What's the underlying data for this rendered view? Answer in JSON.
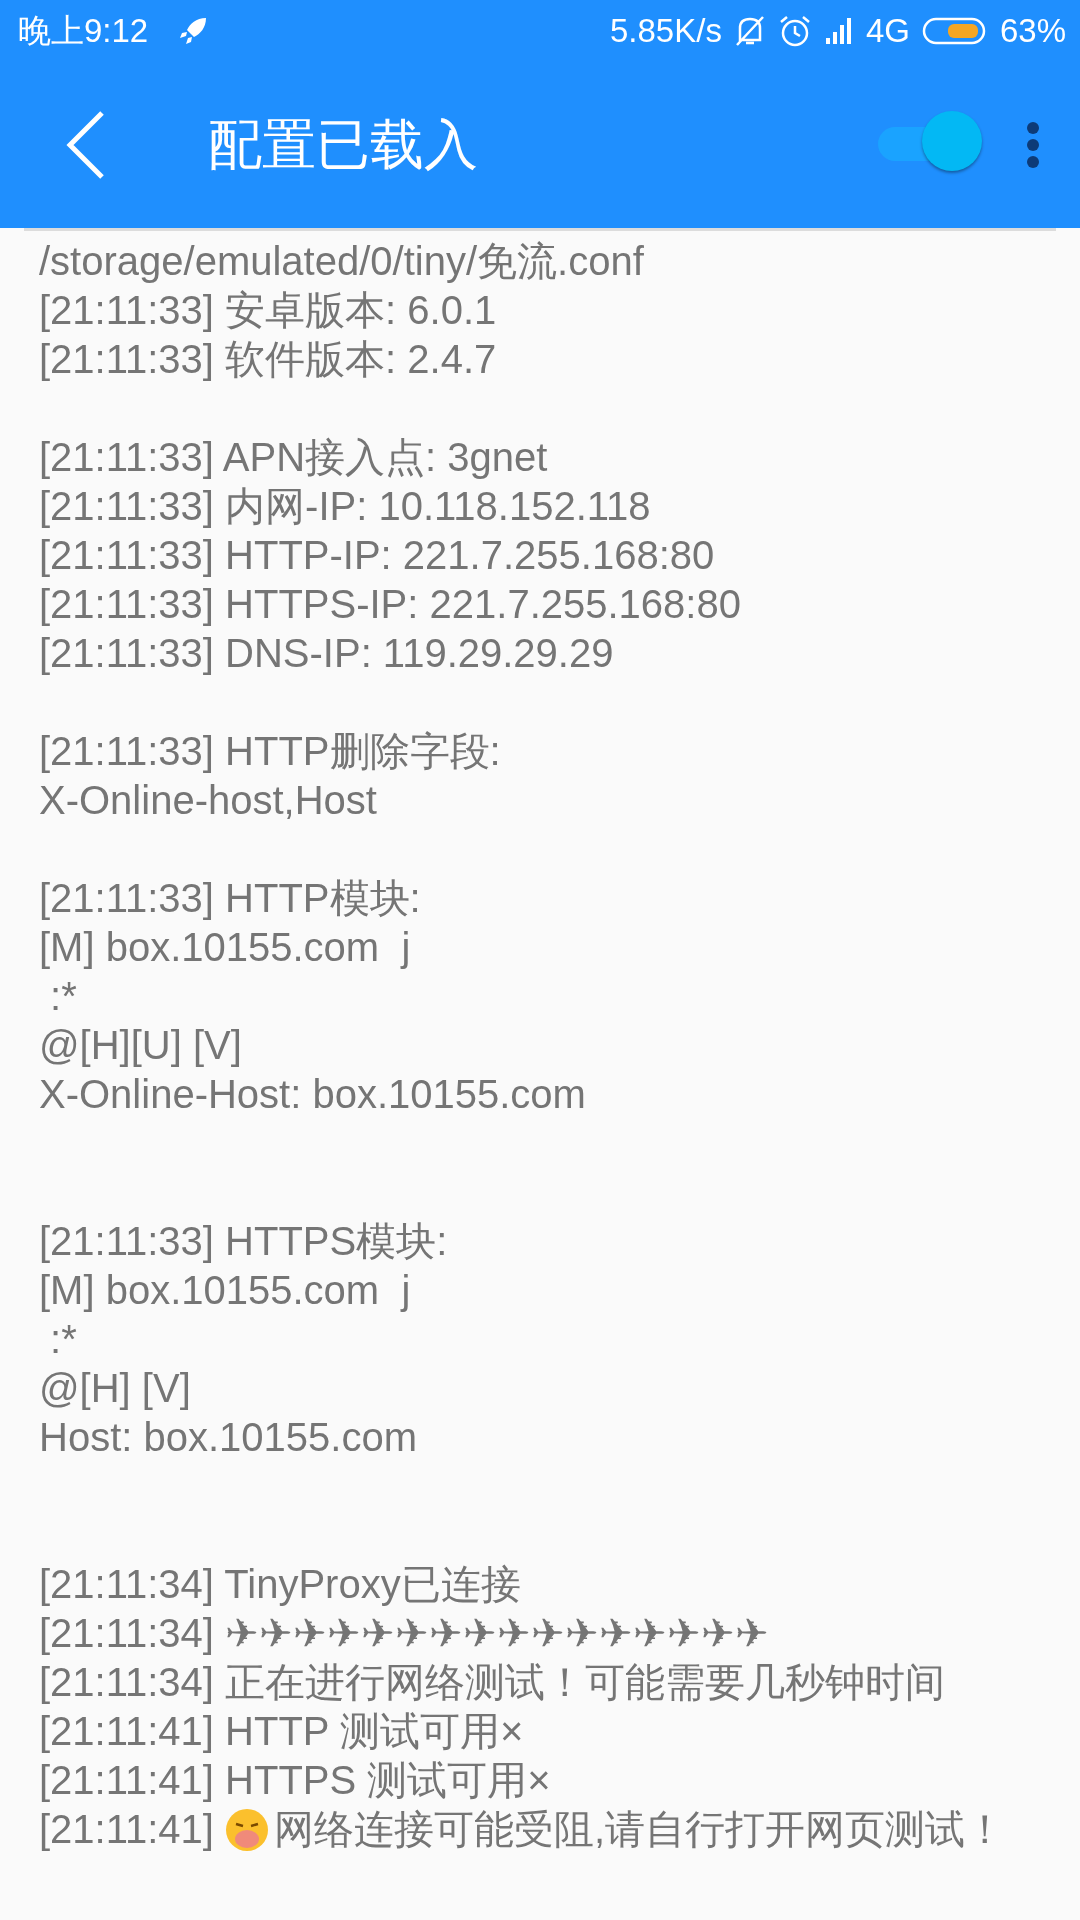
{
  "status_bar": {
    "time": "晚上9:12",
    "speed": "5.85K/s",
    "network": "4G",
    "battery": "63%"
  },
  "app_bar": {
    "title": "配置已载入",
    "toggle": {
      "on": true
    }
  },
  "log": [
    {
      "kind": "text",
      "text": "/storage/emulated/0/tiny/免流.conf"
    },
    {
      "kind": "text",
      "text": "[21:11:33] 安卓版本: 6.0.1"
    },
    {
      "kind": "text",
      "text": "[21:11:33] 软件版本: 2.4.7"
    },
    {
      "kind": "blank"
    },
    {
      "kind": "text",
      "text": "[21:11:33] APN接入点: 3gnet"
    },
    {
      "kind": "text",
      "text": "[21:11:33] 内网-IP: 10.118.152.118"
    },
    {
      "kind": "text",
      "text": "[21:11:33] HTTP-IP: 221.7.255.168:80"
    },
    {
      "kind": "text",
      "text": "[21:11:33] HTTPS-IP: 221.7.255.168:80"
    },
    {
      "kind": "text",
      "text": "[21:11:33] DNS-IP: 119.29.29.29"
    },
    {
      "kind": "blank"
    },
    {
      "kind": "text",
      "text": "[21:11:33] HTTP删除字段:"
    },
    {
      "kind": "text",
      "text": "X-Online-host,Host"
    },
    {
      "kind": "blank"
    },
    {
      "kind": "text",
      "text": "[21:11:33] HTTP模块:"
    },
    {
      "kind": "text",
      "text": "[M] box.10155.com  j"
    },
    {
      "kind": "text",
      "text": " :*"
    },
    {
      "kind": "text",
      "text": "@[H][U] [V]"
    },
    {
      "kind": "text",
      "text": "X-Online-Host: box.10155.com"
    },
    {
      "kind": "blank"
    },
    {
      "kind": "blank"
    },
    {
      "kind": "text",
      "text": "[21:11:33] HTTPS模块:"
    },
    {
      "kind": "text",
      "text": "[M] box.10155.com  j"
    },
    {
      "kind": "text",
      "text": " :*"
    },
    {
      "kind": "text",
      "text": "@[H] [V]"
    },
    {
      "kind": "text",
      "text": "Host: box.10155.com"
    },
    {
      "kind": "blank"
    },
    {
      "kind": "blank"
    },
    {
      "kind": "text",
      "text": "[21:11:34] TinyProxy已连接"
    },
    {
      "kind": "text",
      "text": "[21:11:34] ✈✈✈✈✈✈✈✈✈✈✈✈✈✈✈✈"
    },
    {
      "kind": "text",
      "text": "[21:11:34] 正在进行网络测试！可能需要几秒钟时间"
    },
    {
      "kind": "text",
      "text": "[21:11:41] HTTP 测试可用×"
    },
    {
      "kind": "text",
      "text": "[21:11:41] HTTPS 测试可用×"
    },
    {
      "kind": "emoji",
      "prefix": "[21:11:41]",
      "text": "网络连接可能受阻,请自行打开网页测试！"
    }
  ]
}
